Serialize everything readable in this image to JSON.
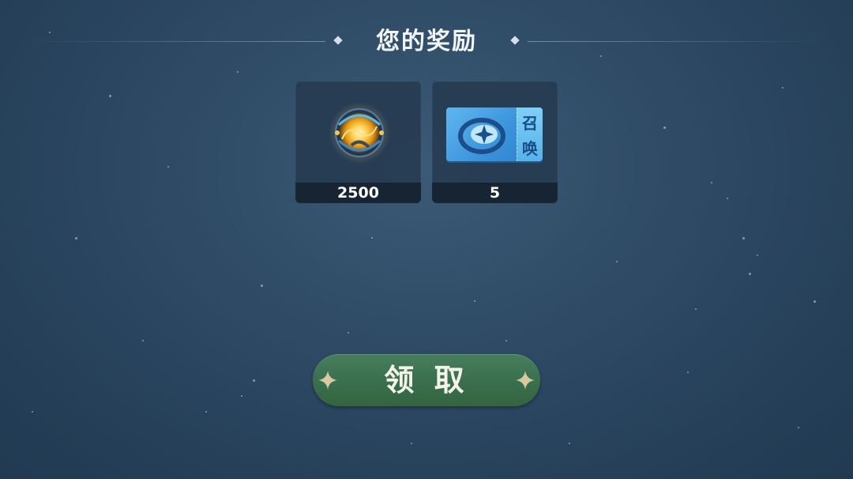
{
  "header": {
    "title": "您的奖励"
  },
  "rewards": [
    {
      "icon": "energy-orb-icon",
      "count": "2500"
    },
    {
      "icon": "summon-ticket-icon",
      "count": "5",
      "ticket_text_top": "召",
      "ticket_text_bottom": "唤"
    }
  ],
  "claim_button": {
    "label": "领 取"
  },
  "colors": {
    "button_green": "#3a6e4d",
    "ticket_blue": "#3b93db",
    "orb_gold": "#f4b42c"
  }
}
